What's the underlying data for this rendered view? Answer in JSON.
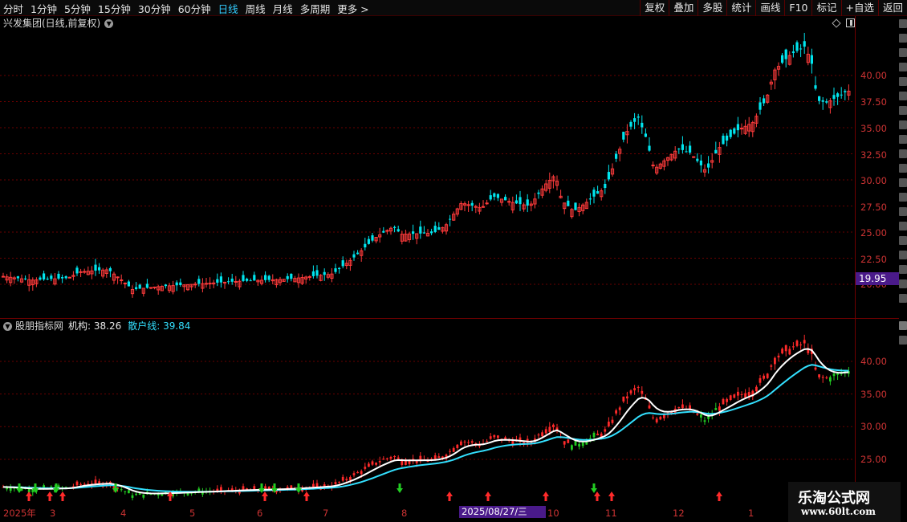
{
  "toolbar": {
    "periods": [
      "分时",
      "1分钟",
      "5分钟",
      "15分钟",
      "30分钟",
      "60分钟",
      "日线",
      "周线",
      "月线",
      "多周期",
      "更多 >"
    ],
    "active_index": 6,
    "right_buttons": [
      "复权",
      "叠加",
      "多股",
      "统计",
      "画线",
      "F10",
      "标记",
      "+自选",
      "返回"
    ]
  },
  "main_chart": {
    "title": "兴发集团(日线,前复权)",
    "price_axis": [
      "40.00",
      "37.50",
      "35.00",
      "32.50",
      "30.00",
      "27.50",
      "25.00",
      "22.50",
      "20.00"
    ],
    "current_price_tag": "19.95"
  },
  "indicator": {
    "name": "股朋指标网",
    "line1_label": "机构: 38.26",
    "line2_label": "散户线: 39.84",
    "axis": [
      "40.00",
      "35.00",
      "30.00",
      "25.00"
    ]
  },
  "dates": {
    "labels": [
      "2025年",
      "3",
      "4",
      "5",
      "6",
      "7",
      "8",
      "10",
      "11",
      "12",
      "1"
    ],
    "selected": "2025/08/27/三"
  },
  "watermark": {
    "line1": "乐淘公式网",
    "line2": "www.60lt.com"
  },
  "colors": {
    "up": "#ff3b3b",
    "down": "#00e5ee",
    "line1": "#ffffff",
    "line2": "#33e0ff",
    "bull": "#ff2a2a",
    "bear": "#22cc22"
  }
}
